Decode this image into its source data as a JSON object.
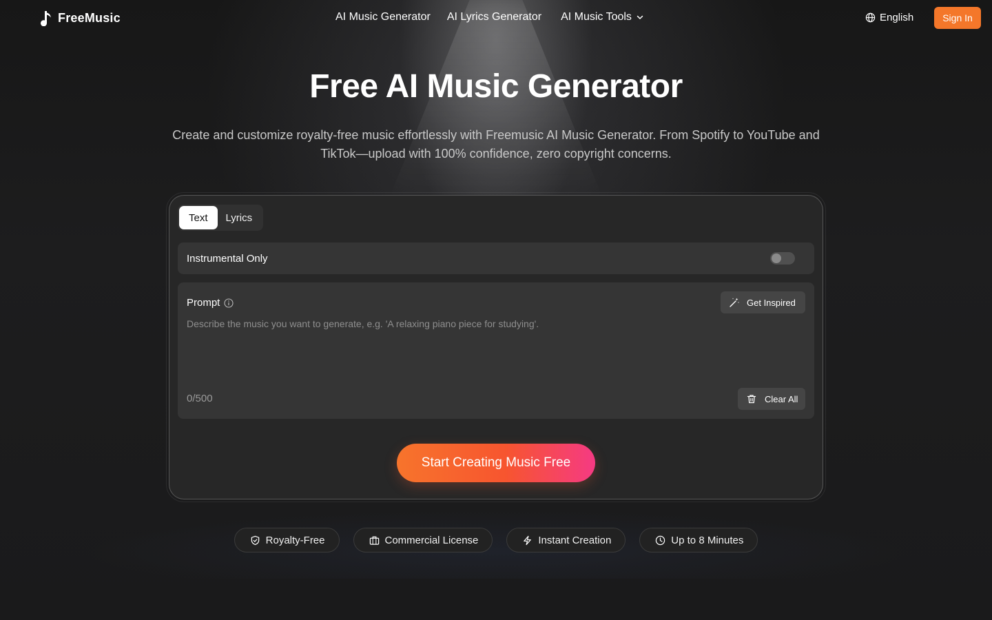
{
  "header": {
    "brand": "FreeMusic",
    "nav": {
      "music_generator": "AI Music Generator",
      "lyrics_generator": "AI Lyrics Generator",
      "tools": "AI Music Tools"
    },
    "language": "English",
    "sign_in": "Sign In"
  },
  "hero": {
    "title": "Free AI Music Generator",
    "description": "Create and customize royalty-free music effortlessly with Freemusic AI Music Generator. From Spotify to YouTube and TikTok—upload with 100% confidence, zero copyright concerns."
  },
  "generator": {
    "tabs": {
      "text": "Text",
      "lyrics": "Lyrics"
    },
    "active_tab": "Text",
    "instrumental_label": "Instrumental Only",
    "instrumental_on": false,
    "prompt_label": "Prompt",
    "get_inspired": "Get Inspired",
    "prompt_value": "",
    "prompt_placeholder": "Describe the music you want to generate, e.g. 'A relaxing piano piece for studying'.",
    "char_count": "0/500",
    "clear_all": "Clear All",
    "cta": "Start Creating Music Free"
  },
  "features": {
    "royalty_free": "Royalty-Free",
    "commercial": "Commercial License",
    "instant": "Instant Creation",
    "duration": "Up to 8 Minutes"
  },
  "colors": {
    "accent": "#f4772a",
    "cta_gradient_start": "#f7742c",
    "cta_gradient_end": "#f53a83",
    "background": "#1b1b1b",
    "card": "#272727"
  },
  "icons": {
    "logo": "music-note-icon",
    "language": "globe-icon",
    "tools_dropdown": "chevron-down-icon",
    "prompt_info": "info-icon",
    "get_inspired": "magic-wand-icon",
    "clear_all": "trash-icon",
    "royalty_free": "shield-check-icon",
    "commercial": "briefcase-icon",
    "instant": "lightning-icon",
    "duration": "clock-icon"
  }
}
